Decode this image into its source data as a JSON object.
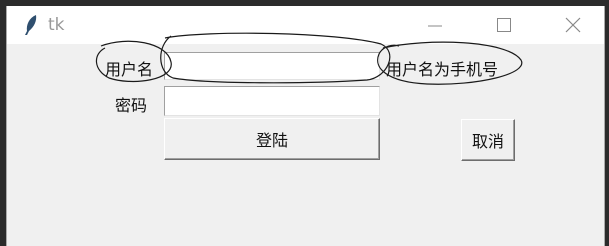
{
  "window": {
    "title": "tk",
    "icons": {
      "app": "feather-icon",
      "minimize": "minimize-icon",
      "maximize": "maximize-icon",
      "close": "close-icon"
    }
  },
  "form": {
    "username_label": "用户名",
    "username_value": "",
    "username_hint": "用户名为手机号",
    "password_label": "密码",
    "password_value": "",
    "login_button": "登陆",
    "cancel_button": "取消"
  },
  "colors": {
    "titlebar": "#ffffff",
    "client_area": "#f0f0f0",
    "scribble_ink": "#1a1a1a"
  }
}
